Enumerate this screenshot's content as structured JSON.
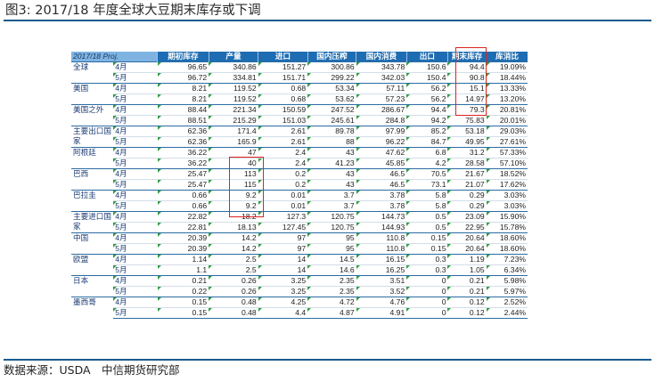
{
  "figure": {
    "title": "图3: 2017/18 年度全球大豆期末库存或下调",
    "source": "数据来源：USDA　中信期货研究部"
  },
  "table": {
    "columns": [
      "2017/18 Proj.",
      "",
      "期初库存",
      "产量",
      "进口",
      "国内压榨",
      "国内消费",
      "出口",
      "期末库存",
      "库消比"
    ],
    "rows": [
      {
        "country": "全球",
        "month": "4月",
        "values": [
          "96.65",
          "340.86",
          "151.27",
          "300.86",
          "343.78",
          "150.6",
          "94.4",
          "19.09%"
        ]
      },
      {
        "country": "",
        "month": "5月",
        "values": [
          "96.72",
          "334.81",
          "151.71",
          "299.22",
          "342.03",
          "150.4",
          "90.8",
          "18.44%"
        ]
      },
      {
        "country": "美国",
        "month": "4月",
        "values": [
          "8.21",
          "119.52",
          "0.68",
          "53.34",
          "57.11",
          "56.2",
          "15.1",
          "13.33%"
        ]
      },
      {
        "country": "",
        "month": "5月",
        "values": [
          "8.21",
          "119.52",
          "0.68",
          "53.62",
          "57.23",
          "56.2",
          "14.97",
          "13.20%"
        ]
      },
      {
        "country": "美国之外",
        "month": "4月",
        "values": [
          "88.44",
          "221.34",
          "150.59",
          "247.52",
          "286.67",
          "94.4",
          "79.3",
          "20.81%"
        ]
      },
      {
        "country": "",
        "month": "5月",
        "values": [
          "88.51",
          "215.29",
          "151.03",
          "245.61",
          "284.8",
          "94.2",
          "75.83",
          "20.01%"
        ]
      },
      {
        "country": "主要出口国",
        "month": "4月",
        "values": [
          "62.36",
          "171.4",
          "2.61",
          "89.78",
          "97.99",
          "85.2",
          "53.18",
          "29.03%"
        ]
      },
      {
        "country": "家",
        "month": "5月",
        "values": [
          "62.36",
          "165.9",
          "2.61",
          "88",
          "96.22",
          "84.7",
          "49.95",
          "27.61%"
        ]
      },
      {
        "country": "阿根廷",
        "month": "4月",
        "values": [
          "36.22",
          "47",
          "2.4",
          "43",
          "47.62",
          "6.8",
          "31.2",
          "57.33%"
        ]
      },
      {
        "country": "",
        "month": "5月",
        "values": [
          "36.22",
          "40",
          "2.4",
          "41.23",
          "45.85",
          "4.2",
          "28.58",
          "57.10%"
        ]
      },
      {
        "country": "巴西",
        "month": "4月",
        "values": [
          "25.47",
          "113",
          "0.2",
          "43",
          "46.5",
          "70.5",
          "21.67",
          "18.52%"
        ]
      },
      {
        "country": "",
        "month": "5月",
        "values": [
          "25.47",
          "115",
          "0.2",
          "43",
          "46.5",
          "73.1",
          "21.07",
          "17.62%"
        ]
      },
      {
        "country": "巴拉圭",
        "month": "4月",
        "values": [
          "0.66",
          "9.2",
          "0.01",
          "3.7",
          "3.78",
          "5.8",
          "0.29",
          "3.03%"
        ]
      },
      {
        "country": "",
        "month": "5月",
        "values": [
          "0.66",
          "9.2",
          "0.01",
          "3.7",
          "3.78",
          "5.8",
          "0.29",
          "3.03%"
        ]
      },
      {
        "country": "主要进口国",
        "month": "4月",
        "values": [
          "22.82",
          "18.2",
          "127.3",
          "120.75",
          "144.73",
          "0.5",
          "23.09",
          "15.90%"
        ]
      },
      {
        "country": "家",
        "month": "5月",
        "values": [
          "22.81",
          "18.13",
          "127.45",
          "120.75",
          "144.93",
          "0.5",
          "22.95",
          "15.78%"
        ]
      },
      {
        "country": "中国",
        "month": "4月",
        "values": [
          "20.39",
          "14.2",
          "97",
          "95",
          "110.8",
          "0.15",
          "20.64",
          "18.60%"
        ]
      },
      {
        "country": "",
        "month": "5月",
        "values": [
          "20.39",
          "14.2",
          "97",
          "95",
          "110.8",
          "0.15",
          "20.64",
          "18.60%"
        ]
      },
      {
        "country": "欧盟",
        "month": "4月",
        "values": [
          "1.14",
          "2.5",
          "14",
          "14.5",
          "16.15",
          "0.3",
          "1.19",
          "7.23%"
        ]
      },
      {
        "country": "",
        "month": "5月",
        "values": [
          "1.1",
          "2.5",
          "14",
          "14.6",
          "16.25",
          "0.3",
          "1.05",
          "6.34%"
        ]
      },
      {
        "country": "日本",
        "month": "4月",
        "values": [
          "0.21",
          "0.26",
          "3.25",
          "2.35",
          "3.51",
          "0",
          "0.21",
          "5.98%"
        ]
      },
      {
        "country": "",
        "month": "5月",
        "values": [
          "0.22",
          "0.26",
          "3.25",
          "2.35",
          "3.52",
          "0",
          "0.21",
          "5.97%"
        ]
      },
      {
        "country": "墨西哥",
        "month": "4月",
        "values": [
          "0.15",
          "0.48",
          "4.25",
          "4.72",
          "4.76",
          "0",
          "0.12",
          "2.52%"
        ]
      },
      {
        "country": "",
        "month": "5月",
        "values": [
          "0.15",
          "0.48",
          "4.4",
          "4.87",
          "4.91",
          "0",
          "0.12",
          "2.44%"
        ]
      }
    ]
  },
  "highlight_color": "#dd2222"
}
